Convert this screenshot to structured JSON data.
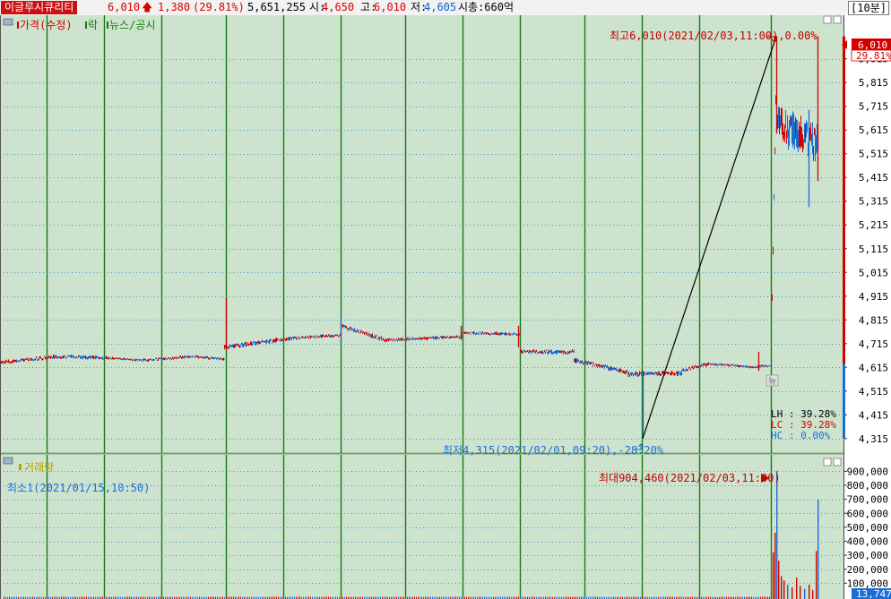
{
  "header": {
    "name": "이글루시큐리티",
    "price": "6,010",
    "change": "1,380",
    "change_pct": "(29.81%)",
    "volume": "5,651,255",
    "open_label": "시:",
    "open": "4,650",
    "high_label": "고:",
    "high": "6,010",
    "low_label": "저:",
    "low": "4,605",
    "mcap": "시총:660억",
    "interval": "[10분]"
  },
  "price_panel": {
    "legend": [
      "가격(수정)",
      "락",
      "뉴스/공시"
    ],
    "max_label": "최고6,010(2021/02/03,11:00),0.00%",
    "min_label": "최저4,315(2021/02/01,09:20),-28.20%",
    "current_price": "6,010",
    "current_pct": "29.81%",
    "news_marker": "뉴",
    "stats": [
      "LH : 39.28%",
      "LC : 39.28%",
      "HC :  0.00%"
    ]
  },
  "volume_panel": {
    "legend": "거래량",
    "min_label": "최소1(2021/01/15,10:50)",
    "max_label": "최대904,460(2021/02/03,11:00)",
    "current_volume": "13,747"
  },
  "colors": {
    "bg": "#cde3cd",
    "grid_dots": "#3a9ad0",
    "vline": "#177a17",
    "up": "#d40000",
    "down": "#1a6ed8",
    "label_blue": "#1a6ed8"
  },
  "chart_data": [
    {
      "type": "candlestick",
      "series_name": "가격(수정)",
      "yticks": [
        4315,
        4415,
        4515,
        4615,
        4715,
        4815,
        4915,
        5015,
        5115,
        5215,
        5315,
        5415,
        5515,
        5615,
        5715,
        5815,
        5915
      ],
      "ylim": [
        4250,
        6080
      ],
      "high": 6010,
      "low": 4315,
      "close": 6010,
      "segments": [
        {
          "from": 0,
          "to": 60,
          "start": 4635,
          "end": 4660,
          "amp": 12
        },
        {
          "from": 60,
          "to": 120,
          "start": 4660,
          "end": 4655,
          "amp": 12
        },
        {
          "from": 120,
          "to": 160,
          "start": 4655,
          "end": 4645,
          "amp": 8
        },
        {
          "from": 160,
          "to": 210,
          "start": 4645,
          "end": 4660,
          "amp": 10
        },
        {
          "from": 210,
          "to": 250,
          "start": 4660,
          "end": 4650,
          "amp": 10
        },
        {
          "from": 250,
          "to": 330,
          "start": 4700,
          "end": 4740,
          "amp": 14
        },
        {
          "from": 330,
          "to": 380,
          "start": 4740,
          "end": 4750,
          "amp": 10
        },
        {
          "from": 380,
          "to": 430,
          "start": 4790,
          "end": 4730,
          "amp": 14
        },
        {
          "from": 430,
          "to": 515,
          "start": 4730,
          "end": 4745,
          "amp": 10
        },
        {
          "from": 515,
          "to": 580,
          "start": 4760,
          "end": 4755,
          "amp": 10
        },
        {
          "from": 580,
          "to": 640,
          "start": 4680,
          "end": 4680,
          "amp": 14
        },
        {
          "from": 640,
          "to": 700,
          "start": 4645,
          "end": 4595,
          "amp": 14
        },
        {
          "from": 700,
          "to": 760,
          "start": 4585,
          "end": 4590,
          "amp": 16
        },
        {
          "from": 760,
          "to": 790,
          "start": 4600,
          "end": 4630,
          "amp": 12
        },
        {
          "from": 790,
          "to": 845,
          "start": 4630,
          "end": 4615,
          "amp": 8
        },
        {
          "from": 845,
          "to": 860,
          "start": 4620,
          "end": 4620,
          "amp": 8
        },
        {
          "from": 861,
          "to": 866,
          "start": 4900,
          "end": 5960,
          "amp": 40
        },
        {
          "from": 866,
          "to": 912,
          "start": 5650,
          "end": 5550,
          "amp": 110
        }
      ],
      "spikes": [
        {
          "x": 252,
          "high": 4910,
          "low": 4690
        },
        {
          "x": 380,
          "high": 4830,
          "low": 4720
        },
        {
          "x": 514,
          "high": 4790,
          "low": 4730
        },
        {
          "x": 578,
          "high": 4790,
          "low": 4700
        },
        {
          "x": 717,
          "high": 4600,
          "low": 4315
        },
        {
          "x": 846,
          "high": 4680,
          "low": 4600
        },
        {
          "x": 866,
          "high": 6010,
          "low": 5600
        },
        {
          "x": 902,
          "high": 5700,
          "low": 5290
        },
        {
          "x": 912,
          "high": 6010,
          "low": 5400
        }
      ],
      "trendline": [
        [
          717,
          4315
        ],
        [
          866,
          6010
        ]
      ]
    },
    {
      "type": "bar",
      "series_name": "거래량",
      "yticks": [
        100000,
        200000,
        300000,
        400000,
        500000,
        600000,
        700000,
        800000,
        900000
      ],
      "ylim": [
        0,
        960000
      ],
      "max": 904460,
      "min": 1,
      "baseline": 2000,
      "spikes": [
        {
          "x": 862,
          "value": 320000
        },
        {
          "x": 864,
          "value": 460000
        },
        {
          "x": 866,
          "value": 904460
        },
        {
          "x": 868,
          "value": 260000
        },
        {
          "x": 871,
          "value": 150000
        },
        {
          "x": 874,
          "value": 120000
        },
        {
          "x": 878,
          "value": 90000
        },
        {
          "x": 883,
          "value": 70000
        },
        {
          "x": 888,
          "value": 140000
        },
        {
          "x": 892,
          "value": 80000
        },
        {
          "x": 897,
          "value": 60000
        },
        {
          "x": 902,
          "value": 90000
        },
        {
          "x": 906,
          "value": 50000
        },
        {
          "x": 910,
          "value": 330000
        },
        {
          "x": 912,
          "value": 700000
        }
      ]
    }
  ]
}
